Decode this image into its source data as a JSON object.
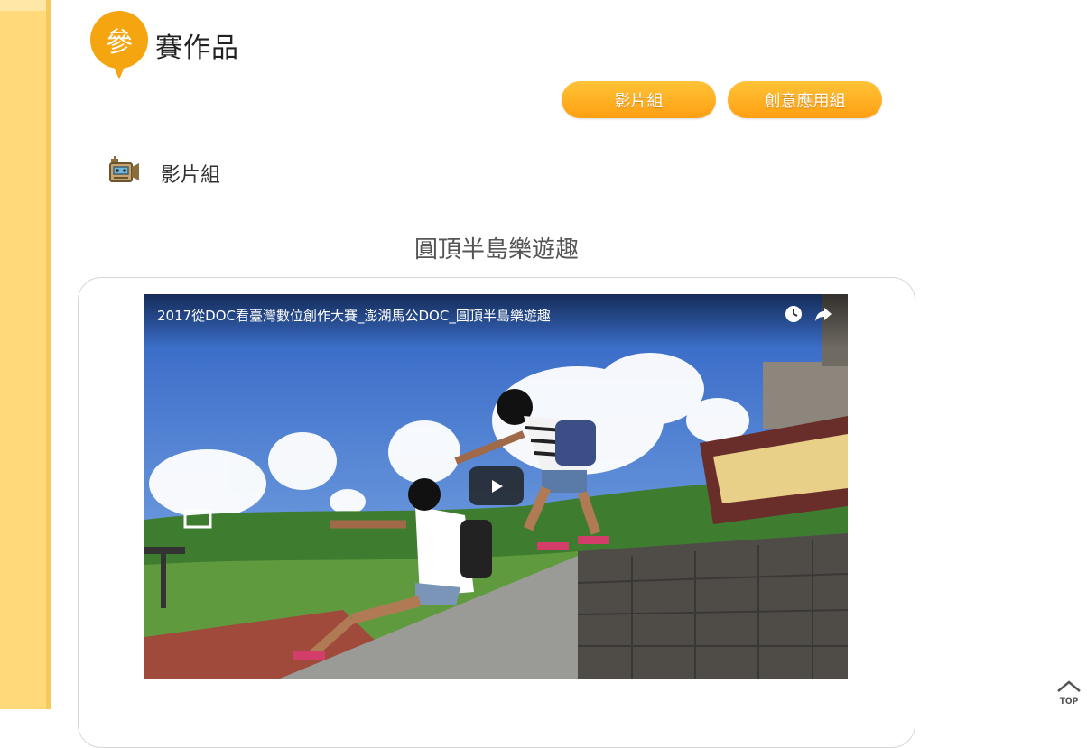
{
  "heading": {
    "badge_char": "參",
    "title": "賽作品"
  },
  "category_buttons": [
    {
      "label": "影片組"
    },
    {
      "label": "創意應用組"
    }
  ],
  "group": {
    "title": "影片組"
  },
  "entry": {
    "title": "圓頂半島樂遊趣",
    "video_caption": "2017從DOC看臺灣數位創作大賽_澎湖馬公DOC_圓頂半島樂遊趣"
  },
  "top_button": {
    "label": "TOP"
  },
  "colors": {
    "accent": "#f5a50f",
    "side_strip": "#ffd97a",
    "button_gradient_top": "#ffc337",
    "button_gradient_bottom": "#ff9f12"
  },
  "icons": [
    "video-camera-icon",
    "clock-icon",
    "share-icon",
    "play-icon",
    "top-arrow-icon"
  ]
}
